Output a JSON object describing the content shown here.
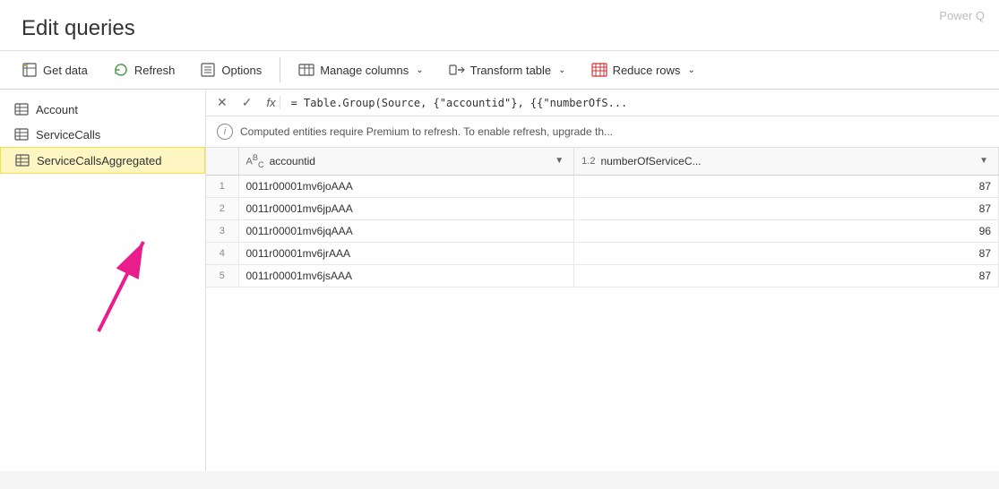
{
  "app": {
    "watermark": "Power Q"
  },
  "title_bar": {
    "title": "Edit queries"
  },
  "toolbar": {
    "get_data_label": "Get data",
    "refresh_label": "Refresh",
    "options_label": "Options",
    "manage_columns_label": "Manage columns",
    "transform_table_label": "Transform table",
    "reduce_rows_label": "Reduce rows"
  },
  "sidebar": {
    "items": [
      {
        "id": "account",
        "label": "Account",
        "active": false
      },
      {
        "id": "servicecalls",
        "label": "ServiceCalls",
        "active": false
      },
      {
        "id": "servicecallsaggregated",
        "label": "ServiceCallsAggregated",
        "active": true
      }
    ]
  },
  "formula_bar": {
    "formula": "= Table.Group(Source, {\"accountid\"}, {{\"numberOfS..."
  },
  "info_bar": {
    "message": "Computed entities require Premium to refresh. To enable refresh, upgrade th..."
  },
  "table": {
    "columns": [
      {
        "id": "row-num",
        "label": ""
      },
      {
        "id": "accountid",
        "type_icon": "ABC",
        "label": "accountid"
      },
      {
        "id": "number-of-service-calls",
        "type_icon": "1.2",
        "label": "numberOfServiceC..."
      }
    ],
    "rows": [
      {
        "num": 1,
        "accountid": "0011r00001mv6joAAA",
        "value": 87
      },
      {
        "num": 2,
        "accountid": "0011r00001mv6jpAAA",
        "value": 87
      },
      {
        "num": 3,
        "accountid": "0011r00001mv6jqAAA",
        "value": 96
      },
      {
        "num": 4,
        "accountid": "0011r00001mv6jrAAA",
        "value": 87
      },
      {
        "num": 5,
        "accountid": "0011r00001mv6jsAAA",
        "value": 87
      }
    ]
  }
}
